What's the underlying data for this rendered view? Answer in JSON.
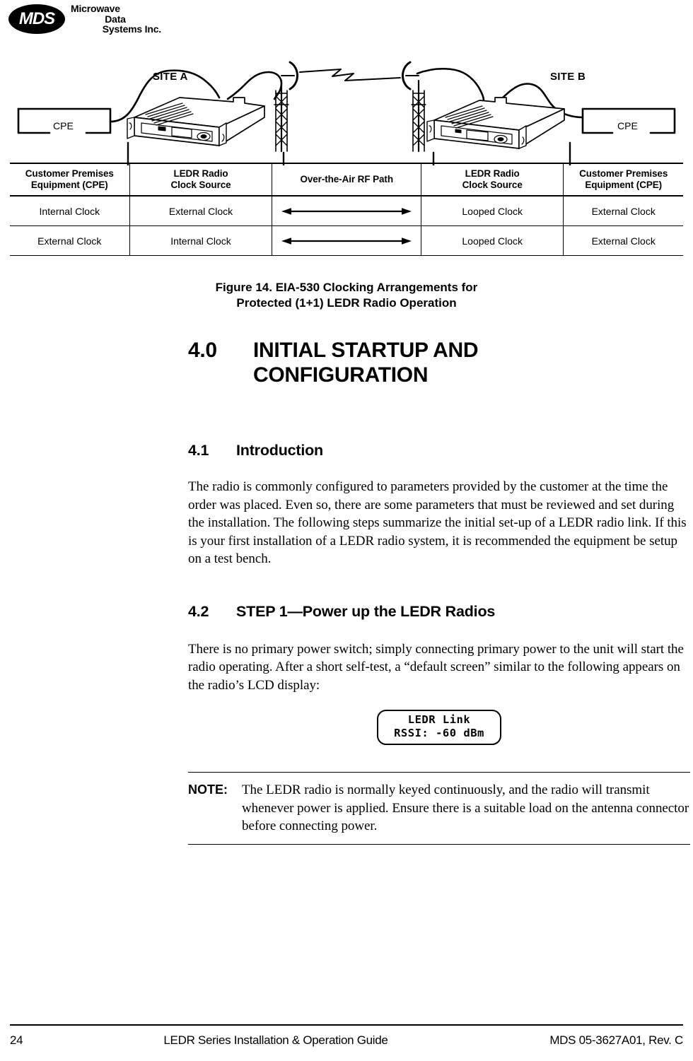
{
  "logo": {
    "mark": "MDS",
    "line1": "Microwave",
    "line2": "Data",
    "line3": "Systems Inc."
  },
  "figure": {
    "site_a_label": "SITE A",
    "site_b_label": "SITE B",
    "cpe_left_label": "CPE",
    "cpe_right_label": "CPE",
    "caption_line1": "Figure 14. EIA-530 Clocking Arrangements for",
    "caption_line2": "Protected (1+1) LEDR Radio Operation"
  },
  "table": {
    "headers": [
      "Customer Premises\nEquipment (CPE)",
      "LEDR Radio\nClock Source",
      "Over-the-Air RF Path",
      "LEDR Radio\nClock Source",
      "Customer Premises\nEquipment (CPE)"
    ],
    "headers_flat": {
      "h1a": "Customer Premises",
      "h1b": "Equipment (CPE)",
      "h2a": "LEDR Radio",
      "h2b": "Clock Source",
      "h3": "Over-the-Air RF Path",
      "h4a": "LEDR Radio",
      "h4b": "Clock Source",
      "h5a": "Customer Premises",
      "h5b": "Equipment (CPE)"
    },
    "rows": [
      {
        "cpe_left": "Internal Clock",
        "clock_left": "External Clock",
        "rf_path": "double-arrow",
        "clock_right": "Looped Clock",
        "cpe_right": "External Clock"
      },
      {
        "cpe_left": "External Clock",
        "clock_left": "Internal Clock",
        "rf_path": "double-arrow",
        "clock_right": "Looped Clock",
        "cpe_right": "External Clock"
      }
    ]
  },
  "sections": {
    "s40": {
      "number": "4.0",
      "title_line1": "INITIAL STARTUP AND",
      "title_line2": "CONFIGURATION"
    },
    "s41": {
      "number": "4.1",
      "title": "Introduction",
      "body": "The radio is commonly configured to parameters provided by the customer at the time the order was placed. Even so, there are some parameters that must be reviewed and set during the installation. The following steps summarize the initial set-up of a LEDR radio link. If this is your first installation of a LEDR radio system, it is recommended the equipment be setup on a test bench."
    },
    "s42": {
      "number": "4.2",
      "title": "STEP 1—Power up the LEDR Radios",
      "body": "There is no primary power switch; simply connecting primary power to the unit will start the radio operating. After a short self-test, a “default screen” similar to the following appears on the radio’s LCD display:"
    }
  },
  "lcd": {
    "line1": "LEDR Link",
    "line2": "RSSI: -60 dBm"
  },
  "note": {
    "label": "NOTE:",
    "text": "The LEDR radio is normally keyed continuously, and the radio will transmit whenever power is applied. Ensure there is a suitable load on the antenna connector before connecting power."
  },
  "footer": {
    "page_number": "24",
    "title": "LEDR Series Installation & Operation Guide",
    "document": "MDS 05-3627A01, Rev. C"
  }
}
